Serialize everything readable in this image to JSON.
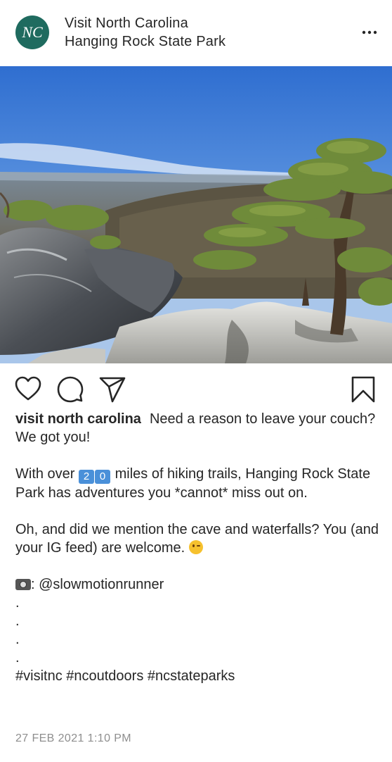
{
  "header": {
    "account_name": "Visit North Carolina",
    "location": "Hanging Rock State Park",
    "avatar_text": "NC",
    "more_icon": "more-horizontal-icon"
  },
  "actions": {
    "like_icon": "heart-icon",
    "comment_icon": "comment-icon",
    "share_icon": "send-icon",
    "save_icon": "bookmark-icon"
  },
  "caption": {
    "username": "visit north carolina",
    "line1": "Need a reason to leave your couch? We got you!",
    "line2_pre": "With over ",
    "line2_num_a": "2",
    "line2_num_b": "0",
    "line2_post": " miles of hiking trails, Hanging Rock State Park has adventures you *cannot* miss out on.",
    "line3": "Oh, and did we mention the cave and waterfalls? You (and your IG feed) are welcome. ",
    "credit": ": @slowmotionrunner",
    "dots": [
      ".",
      ".",
      ".",
      "."
    ],
    "hashtags": "#visitnc #ncoutdoors #ncstateparks"
  },
  "timestamp": "27 FEB 2021 1:10 PM",
  "colors": {
    "avatar_bg": "#1f6b5f",
    "sky_top": "#2e6fd1",
    "text": "#262626",
    "muted": "#8e8e8e"
  }
}
